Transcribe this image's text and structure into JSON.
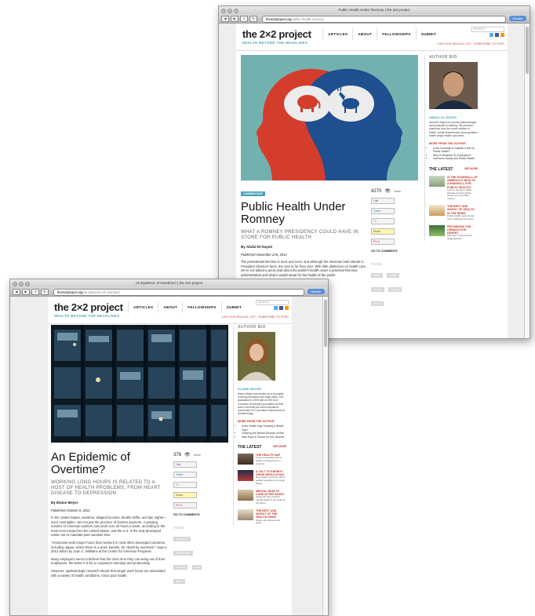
{
  "windows": [
    {
      "title": "Public Health Under Romney | the 2x2 project",
      "url_host": "the2x2project.org",
      "url_path": "/public-health-romney/",
      "reader": "Reader",
      "logo": "the 2×2 project",
      "tagline": "HEALTH BEYOND THE HEADLINES",
      "nav": [
        "ARTICLES",
        "ABOUT",
        "FELLOWSHIPS",
        "SUBMIT"
      ],
      "search_placeholder": "SEARCH",
      "header_links": "JOIN OUR MAILING LIST · SUBSCRIBE TO FEED",
      "badge": "COMMENTARY",
      "article_title": "Public Health Under Romney",
      "subtitle": "WHAT A ROMNEY PRESIDENCY COULD HAVE IN STORE FOR PUBLIC HEALTH",
      "byline": "By Abdul El-Sayed",
      "published": "Published November 2nd, 2012",
      "body": [
        "The presidential election is neck and neck, and although the electoral math stands in President Obama's favor, the race is far from over. With little distinction on health care, we've not talked a great deal about the public's health under a potential Romney administration and what it would mean for the health of the public."
      ],
      "share_count": "4270",
      "share_label": "views",
      "share_buttons": [
        "Like",
        "Tweet",
        "+1",
        "Share",
        "Pin it"
      ],
      "comments": "GO TO COMMENTS",
      "tags_head": "TAGS",
      "tags": [
        "health",
        "politics",
        "election",
        "romney",
        "obama"
      ],
      "sidebar_head": "AUTHOR BIO",
      "author_name": "ABDUL EL-SAYED",
      "author_bio": "Abdul El-Sayed is a social epidemiologist and physician-in-training. His research examines how the social realities of health, social determinants and population health shape health outcomes.",
      "more_head": "MORE FROM THE AUTHOR",
      "more": [
        "Is the Downfall of Gaddafi a Win for Public Health?",
        "Why is Medicare So Expensive?",
        "Hurricane Sandy and Public Health"
      ],
      "latest_head": "THE LATEST",
      "latest_more": "SEE MORE",
      "latest": [
        {
          "t": "IS THE DOWNFALL OF AMERICA'S WEALTH A WINDFALL FOR PUBLIC HEALTH?",
          "d": "Cyprus, the Euro, Miles Morales and the global stories you may have missed."
        },
        {
          "t": "THE BEST AND WORST OF HEALTH IN THE NEWS",
          "d": "Public health news stories we're watching this week."
        },
        {
          "t": "RETHINKING THE URBAN FOOD DESERT",
          "d": "Why aren't food deserts disappearing?"
        }
      ]
    },
    {
      "title": "An Epidemic of Overtime? | the 2x2 project",
      "url_host": "the2x2project.org",
      "url_path": "/an-epidemic-of-overtime/",
      "reader": "Reader",
      "logo": "the 2×2 project",
      "tagline": "HEALTH BEYOND THE HEADLINES",
      "nav": [
        "ARTICLES",
        "ABOUT",
        "FELLOWSHIPS",
        "SUBMIT"
      ],
      "search_placeholder": "SEARCH",
      "header_links": "JOIN OUR MAILING LIST · SUBSCRIBE TO FEED",
      "article_title": "An Epidemic of Overtime?",
      "subtitle": "WORKING LONG HOURS IS RELATED TO A HOST OF HEALTH PROBLEMS, FROM HEART DISEASE TO DEPRESSION",
      "byline": "By Elaine Meyer",
      "published": "Published October 8, 2012",
      "body": [
        "In the United States, overtime, skipped lunches, double shifts, and late nights—even overnights—are not just the province of doctors anymore. A growing number of American workers now work over 40 hours a week, according to the most recent data from the United States, and the U.S. is the only developed nation not to mandate paid vacation time.",
        "\"Americans work longer hours than workers in most other developed countries, including Japan, where there is a word, karoshi, for 'death by overwork,'\" says a 2012 article by Joan C. Williams at the Center for American Progress.",
        "Many employers seem to believe that the more time they can wring out of their employees, the better it is for a company's earnings and productivity.",
        "However, epidemiologic research shows that longer work hours are associated with a variety of health conditions. Since poor health"
      ],
      "share_count": "378",
      "share_label": "views",
      "share_buttons": [
        "Like",
        "Tweet",
        "+1",
        "Share",
        "Pin it"
      ],
      "comments": "GO TO COMMENTS",
      "tags_head": "TAGS",
      "tags": [
        "depression",
        "heart disease",
        "overtime",
        "work",
        "stress"
      ],
      "sidebar_head": "AUTHOR BIO",
      "author_name": "ELAINE MEYER",
      "author_bio": "Elaine Meyer has worked as a journalist covering education and legal news. She graduated in 2009 with an MS from Columbia University's journalism school and is currently the communications coordinator for Columbia's Department of Epidemiology.",
      "more_head": "MORE FROM THE AUTHOR",
      "more": [
        "Is the Health Gap Growing a Health Gap?",
        "Tracking the Mental Wounds of War",
        "New Hope in Sound for HIV Vaccine"
      ],
      "latest_head": "THE LATEST",
      "latest_more": "SEE MORE",
      "latest": [
        {
          "t": "THE HEALTH GAP",
          "d": "Income inequality and its health consequences in America."
        },
        {
          "t": "A JOLT TO ENERGY DRINK REGULATION",
          "d": "New health concerns call for greater regulation of energy drinks."
        },
        {
          "t": "MENTAL HEALTH CARE AFTER SANDY",
          "d": "Caring for New Yorkers' mental health in the wake of the storm."
        },
        {
          "t": "THE BEST AND WORST OF THE HEALTH NEWS",
          "d": "Stories we followed this week."
        }
      ]
    }
  ],
  "colors": {
    "accent": "#4aa3b8",
    "link_red": "#c0392b",
    "poster_bg": "#73b1b0",
    "red_head": "#d43d2c",
    "blue_head": "#1f4f8f"
  }
}
